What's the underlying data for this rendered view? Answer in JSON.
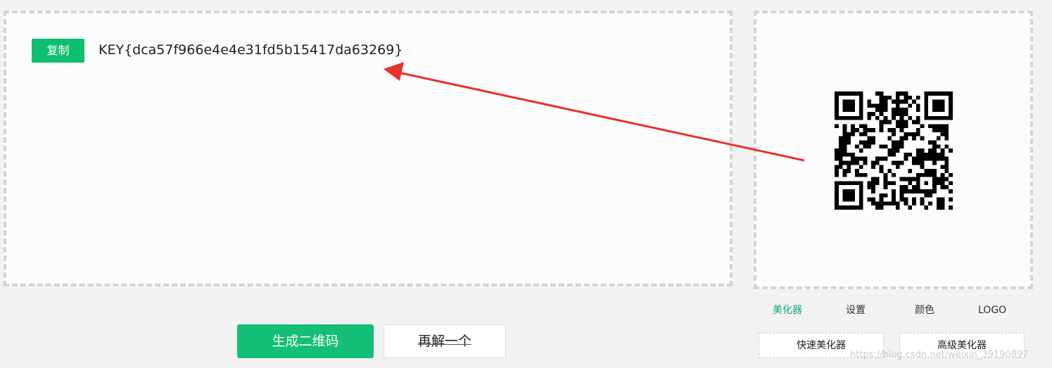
{
  "decode": {
    "copy_label": "复制",
    "result_text": "KEY{dca57f966e4e4e31fd5b15417da63269}"
  },
  "qr_panel": {
    "tabs": [
      {
        "label": "美化器",
        "active": true
      },
      {
        "label": "设置",
        "active": false
      },
      {
        "label": "颜色",
        "active": false
      },
      {
        "label": "LOGO",
        "active": false
      }
    ],
    "quick_beautify_label": "快速美化器",
    "advanced_beautify_label": "高级美化器"
  },
  "actions": {
    "generate_label": "生成二维码",
    "again_label": "再解一个"
  },
  "watermark": "https://blog.csdn.net/weixin_39190897",
  "colors": {
    "accent": "#0fbf70",
    "active_tab": "#0fa86a",
    "arrow": "#e8322a"
  },
  "icons": {
    "qr": "qr-code-icon",
    "arrow": "red-arrow-annotation"
  }
}
